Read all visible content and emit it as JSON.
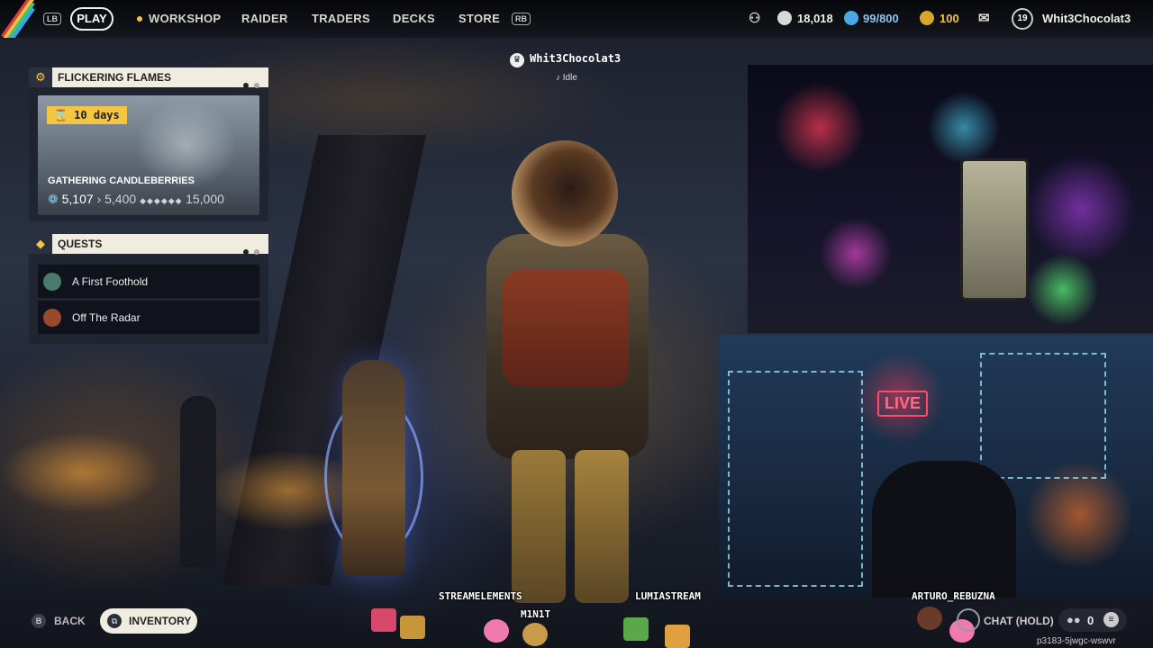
{
  "topbar": {
    "lb": "LB",
    "rb": "RB",
    "play": "PLAY",
    "nav": [
      "WORKSHOP",
      "RAIDER",
      "TRADERS",
      "DECKS",
      "STORE"
    ],
    "currency": {
      "coins": "18,018",
      "tokens": "99/800",
      "creds": "100"
    },
    "level": "19",
    "username": "Whit3Chocolat3"
  },
  "event": {
    "title": "FLICKERING FLAMES",
    "timer": "10 days",
    "name": "GATHERING CANDLEBERRIES",
    "current": "5,107",
    "next": "5,400",
    "max": "15,000"
  },
  "quests": {
    "title": "QUESTS",
    "items": [
      "A First Foothold",
      "Off The Radar"
    ]
  },
  "player": {
    "name": "Whit3Chocolat3",
    "status": "Idle"
  },
  "overlay": {
    "live": "LIVE",
    "labels": [
      "STREAMELEMENTS",
      "M1N1T",
      "LUMIASTREAM",
      "ARTURO_REBUZNA"
    ]
  },
  "bottom": {
    "back_key": "B",
    "back": "BACK",
    "inventory": "INVENTORY",
    "chat": "CHAT (HOLD)",
    "friends_count": "0",
    "session": "p3183-5jwgc-wswvr"
  },
  "colors": {
    "accent": "#f4c542",
    "panel_header": "#f1ece0",
    "live": "#ff4b6b"
  }
}
